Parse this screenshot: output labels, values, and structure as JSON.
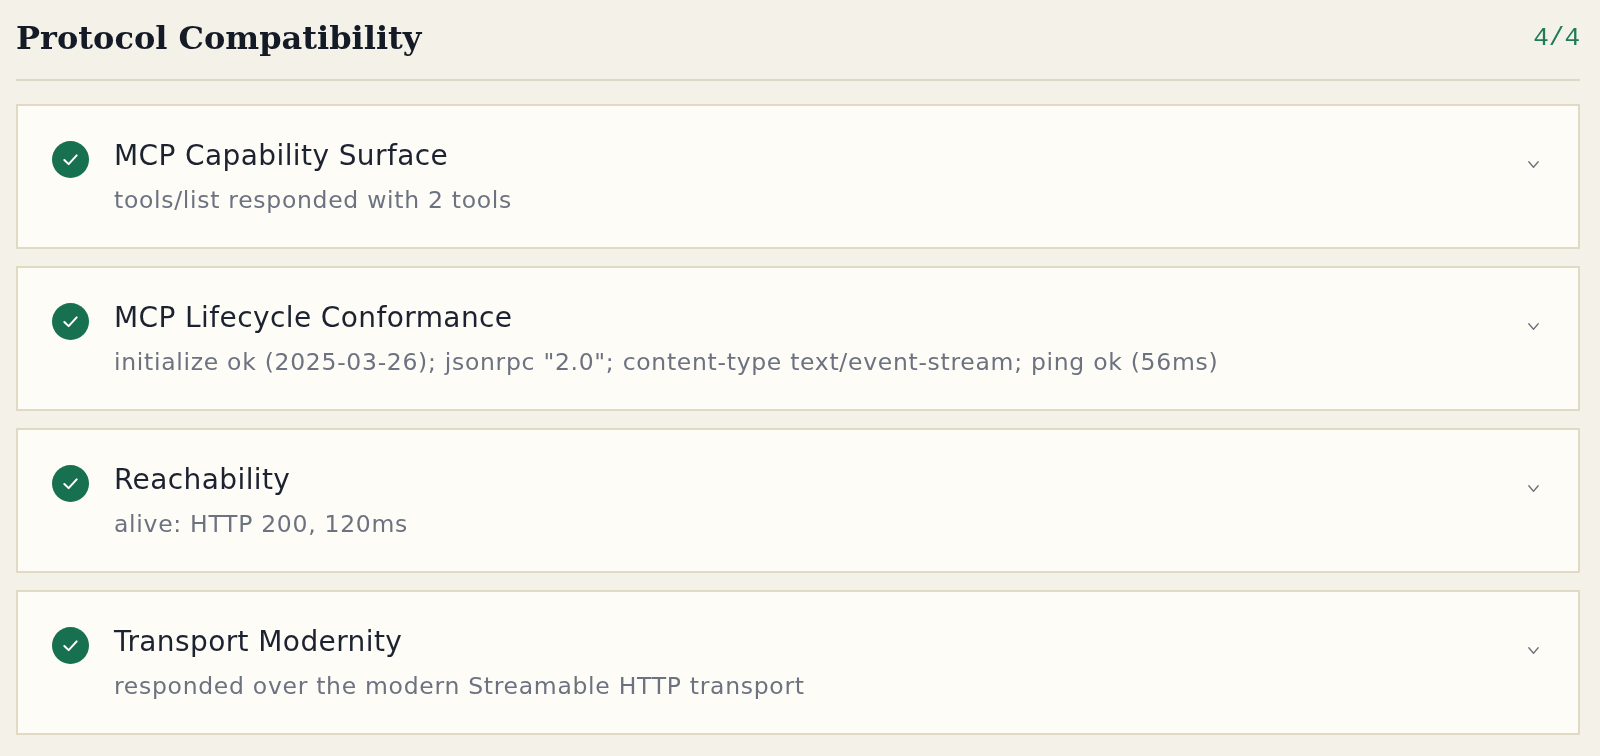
{
  "section": {
    "title": "Protocol Compatibility",
    "score": "4/4"
  },
  "checks": [
    {
      "name": "MCP Capability Surface",
      "detail": "tools/list responded with 2 tools",
      "passed": true,
      "expanded": false
    },
    {
      "name": "MCP Lifecycle Conformance",
      "detail": "initialize ok (2025-03-26); jsonrpc \"2.0\"; content-type text/event-stream; ping ok (56ms)",
      "passed": true,
      "expanded": false
    },
    {
      "name": "Reachability",
      "detail": "alive: HTTP 200, 120ms",
      "passed": true,
      "expanded": false
    },
    {
      "name": "Transport Modernity",
      "detail": "responded over the modern Streamable HTTP transport",
      "passed": true,
      "expanded": false
    }
  ]
}
